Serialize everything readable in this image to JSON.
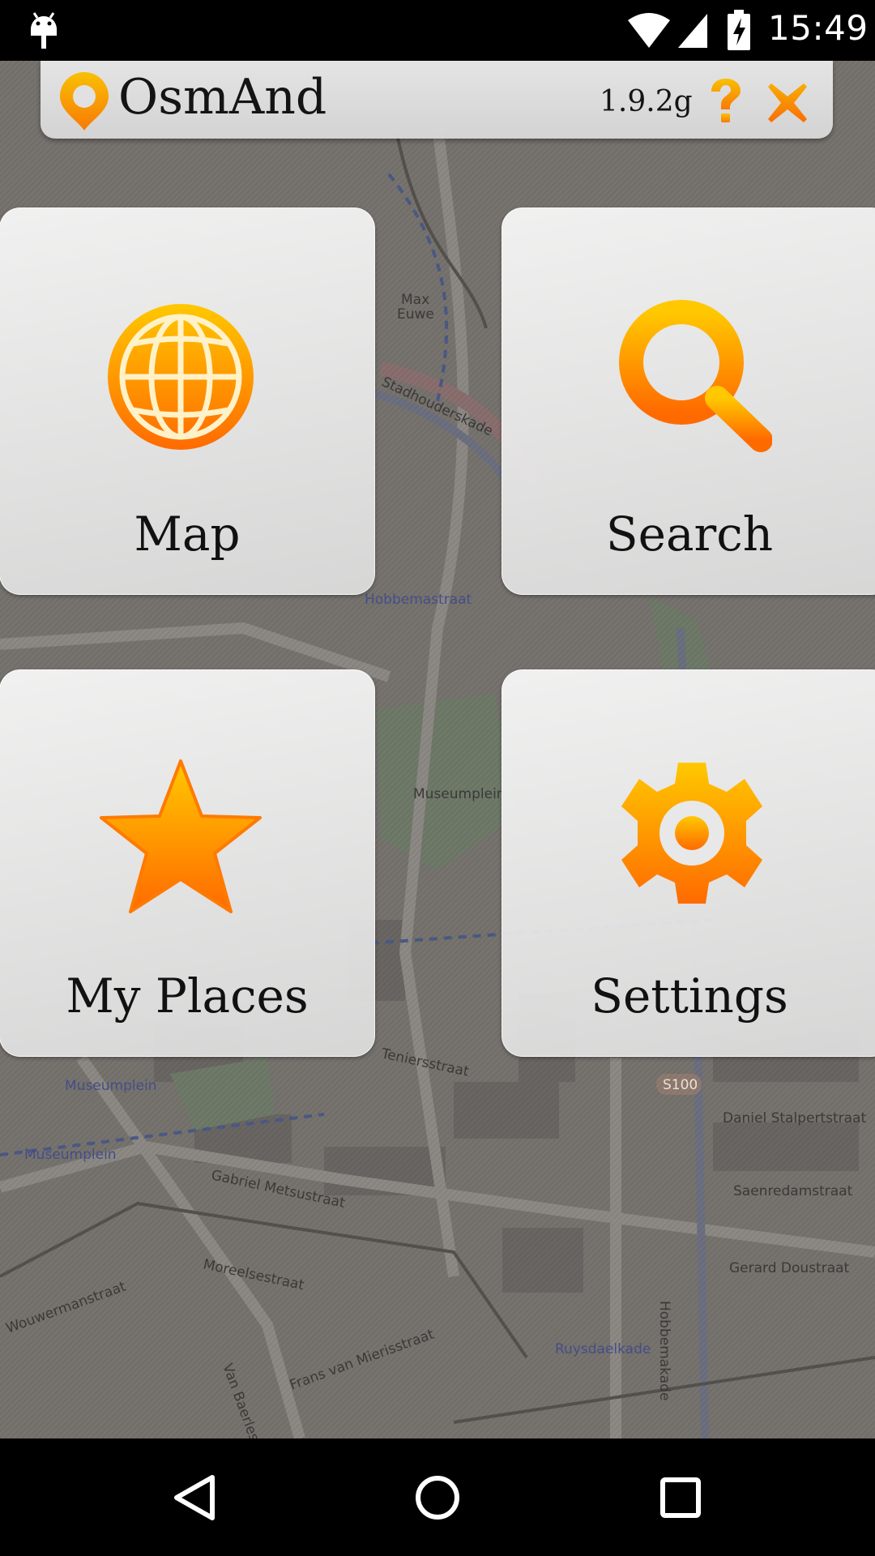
{
  "status_bar": {
    "time": "15:49",
    "icons": [
      "android-notification-icon",
      "wifi-icon",
      "signal-icon",
      "battery-charging-icon"
    ]
  },
  "title_bar": {
    "app_name": "OsmAnd",
    "version": "1.9.2g",
    "icons": [
      "osmand-logo-icon",
      "help-icon",
      "close-icon"
    ]
  },
  "menu": {
    "items": [
      {
        "label": "Map",
        "icon": "globe-icon"
      },
      {
        "label": "Search",
        "icon": "magnifier-icon"
      },
      {
        "label": "My Places",
        "icon": "star-icon"
      },
      {
        "label": "Settings",
        "icon": "gear-icon"
      }
    ]
  },
  "map_labels": [
    "Stadhouderskade",
    "Max Euwe",
    "Hobbemastraat",
    "Museumplein",
    "Teniersstraat",
    "Gabriel Metsustraat",
    "Moreelsestraat",
    "Wouwermanstraat",
    "Frans van Mierisstraat",
    "Daniel Stalpertstraat",
    "Saenredamstraat",
    "Gerard Doustraat",
    "Ruysdaelkade",
    "Hobbemakade",
    "Van Baerlestraat",
    "S100"
  ],
  "colors": {
    "accent_orange": "#ff8a00",
    "accent_yellow": "#ffc400",
    "tile_bg": "#e6e6e6",
    "status_bar_bg": "#000000"
  },
  "nav_bar": {
    "icons": [
      "back-icon",
      "home-icon",
      "recents-icon"
    ]
  }
}
